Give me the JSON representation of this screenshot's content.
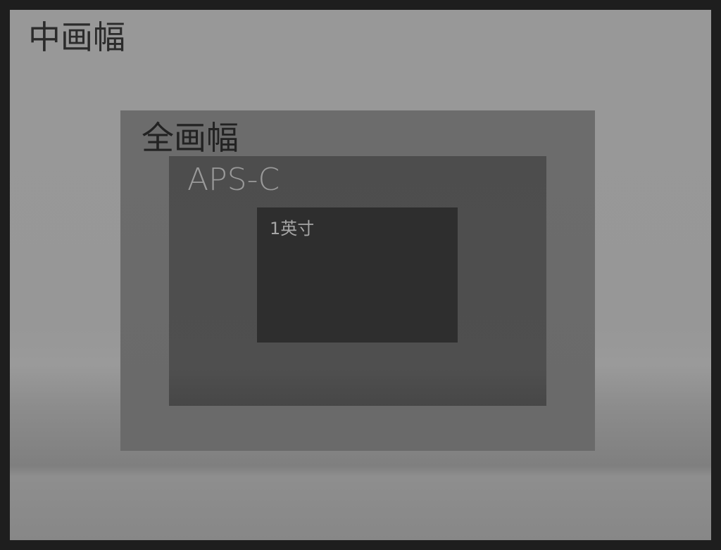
{
  "sensors": {
    "medium_format": {
      "label": "中画幅"
    },
    "full_frame": {
      "label": "全画幅"
    },
    "aps_c": {
      "label": "APS-C"
    },
    "one_inch": {
      "label": "1英寸"
    }
  },
  "colors": {
    "border": "#1e1e1e",
    "medium_format": "#989898",
    "full_frame": "#6c6c6c",
    "aps_c": "#4d4d4d",
    "one_inch": "#2e2e2e"
  }
}
